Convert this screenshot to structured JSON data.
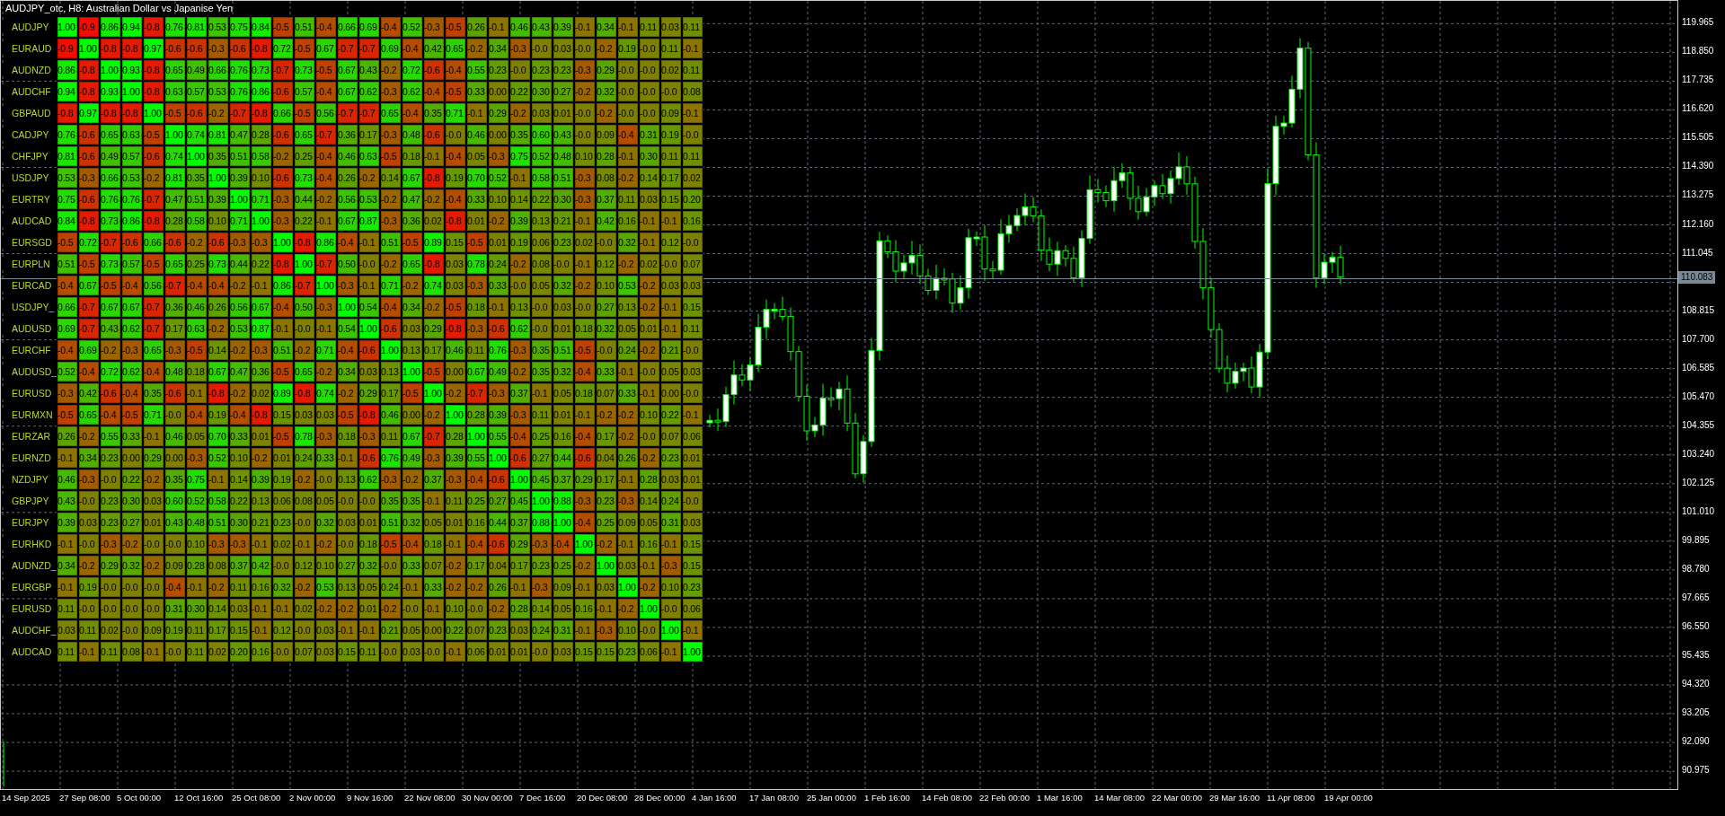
{
  "window": {
    "title": "AUDJPY_otc, H8: Australian Dollar vs Japanise Yen"
  },
  "correlation_matrix": {
    "rows": [
      {
        "symbol": "AUDJPY",
        "values": [
          "1.00",
          "-0.9",
          "0.86",
          "0.94",
          "-0.8",
          "0.76",
          "0.81",
          "0.53",
          "0.75",
          "0.84",
          "-0.5",
          "0.51",
          "-0.4",
          "0.66",
          "0.69",
          "-0.4",
          "0.52",
          "-0.3",
          "-0.5",
          "0.26",
          "-0.1",
          "0.46",
          "0.43",
          "0.39",
          "-0.1",
          "0.34",
          "-0.1",
          "0.11",
          "0.03",
          "0.11"
        ]
      },
      {
        "symbol": "EURAUD",
        "values": [
          "-0.9",
          "1.00",
          "-0.8",
          "-0.8",
          "0.97",
          "-0.6",
          "-0.6",
          "-0.3",
          "-0.6",
          "-0.8",
          "0.72",
          "-0.5",
          "0.67",
          "-0.7",
          "-0.7",
          "0.69",
          "-0.4",
          "0.42",
          "0.65",
          "-0.2",
          "0.34",
          "-0.3",
          "-0.0",
          "0.03",
          "-0.0",
          "-0.2",
          "0.19",
          "-0.0",
          "0.11",
          "-0.1"
        ]
      },
      {
        "symbol": "AUDNZD",
        "values": [
          "0.86",
          "-0.8",
          "1.00",
          "0.93",
          "-0.8",
          "0.65",
          "0.49",
          "0.66",
          "0.76",
          "0.73",
          "-0.7",
          "0.73",
          "-0.5",
          "0.67",
          "0.43",
          "-0.2",
          "0.72",
          "-0.6",
          "-0.4",
          "0.55",
          "0.23",
          "-0.0",
          "0.23",
          "0.23",
          "-0.3",
          "0.29",
          "-0.0",
          "-0.0",
          "0.02",
          "0.11"
        ]
      },
      {
        "symbol": "AUDCHF",
        "values": [
          "0.94",
          "-0.8",
          "0.93",
          "1.00",
          "-0.8",
          "0.63",
          "0.57",
          "0.53",
          "0.76",
          "0.86",
          "-0.6",
          "0.57",
          "-0.4",
          "0.67",
          "0.62",
          "-0.3",
          "0.62",
          "-0.4",
          "-0.5",
          "0.33",
          "0.00",
          "0.22",
          "0.30",
          "0.27",
          "-0.2",
          "0.32",
          "-0.0",
          "-0.0",
          "-0.0",
          "0.08"
        ]
      },
      {
        "symbol": "GBPAUD",
        "values": [
          "-0.8",
          "0.97",
          "-0.8",
          "-0.8",
          "1.00",
          "-0.5",
          "-0.6",
          "-0.2",
          "-0.7",
          "-0.8",
          "0.66",
          "-0.5",
          "0.56",
          "-0.7",
          "-0.7",
          "0.65",
          "-0.4",
          "0.35",
          "0.71",
          "-0.1",
          "0.29",
          "-0.2",
          "0.03",
          "0.01",
          "-0.0",
          "-0.2",
          "-0.0",
          "-0.0",
          "0.09",
          "-0.1"
        ]
      },
      {
        "symbol": "CADJPY",
        "values": [
          "0.76",
          "-0.6",
          "0.65",
          "0.63",
          "-0.5",
          "1.00",
          "0.74",
          "0.81",
          "0.47",
          "0.28",
          "-0.6",
          "0.65",
          "-0.7",
          "0.36",
          "0.17",
          "-0.3",
          "0.48",
          "-0.6",
          "-0.0",
          "0.46",
          "0.00",
          "0.35",
          "0.60",
          "0.43",
          "-0.0",
          "0.09",
          "-0.4",
          "0.31",
          "0.19",
          "-0.0"
        ]
      },
      {
        "symbol": "CHFJPY",
        "values": [
          "0.81",
          "-0.6",
          "0.49",
          "0.57",
          "-0.6",
          "0.74",
          "1.00",
          "0.35",
          "0.51",
          "0.58",
          "-0.2",
          "0.25",
          "-0.4",
          "0.46",
          "0.63",
          "-0.5",
          "0.18",
          "-0.1",
          "-0.4",
          "0.05",
          "-0.3",
          "0.75",
          "0.52",
          "0.48",
          "0.10",
          "0.28",
          "-0.1",
          "0.30",
          "0.11",
          "0.11"
        ]
      },
      {
        "symbol": "USDJPY",
        "values": [
          "0.53",
          "-0.3",
          "0.66",
          "0.53",
          "-0.2",
          "0.81",
          "0.35",
          "1.00",
          "0.39",
          "0.10",
          "-0.6",
          "0.73",
          "-0.4",
          "0.26",
          "-0.2",
          "0.14",
          "0.67",
          "-0.8",
          "0.19",
          "0.70",
          "0.52",
          "-0.1",
          "0.58",
          "0.51",
          "-0.3",
          "0.08",
          "-0.2",
          "0.14",
          "0.17",
          "0.02"
        ]
      },
      {
        "symbol": "EURTRY",
        "values": [
          "0.75",
          "-0.6",
          "0.76",
          "0.76",
          "-0.7",
          "0.47",
          "0.51",
          "0.39",
          "1.00",
          "0.71",
          "-0.3",
          "0.44",
          "-0.2",
          "0.56",
          "0.53",
          "-0.2",
          "0.47",
          "-0.2",
          "-0.4",
          "0.33",
          "0.10",
          "0.14",
          "0.22",
          "0.30",
          "-0.3",
          "0.37",
          "0.11",
          "0.03",
          "0.15",
          "0.20"
        ]
      },
      {
        "symbol": "AUDCAD",
        "values": [
          "0.84",
          "-0.8",
          "0.73",
          "0.86",
          "-0.8",
          "0.28",
          "0.58",
          "0.10",
          "0.71",
          "1.00",
          "-0.3",
          "0.22",
          "-0.1",
          "0.67",
          "0.87",
          "-0.3",
          "0.36",
          "0.02",
          "-0.8",
          "0.01",
          "-0.2",
          "0.39",
          "0.13",
          "0.21",
          "-0.1",
          "0.42",
          "0.16",
          "-0.1",
          "-0.1",
          "0.16"
        ]
      },
      {
        "symbol": "EURSGD",
        "values": [
          "-0.5",
          "0.72",
          "-0.7",
          "-0.6",
          "0.66",
          "-0.6",
          "-0.2",
          "-0.6",
          "-0.3",
          "-0.3",
          "1.00",
          "-0.8",
          "0.86",
          "-0.4",
          "-0.1",
          "0.51",
          "-0.5",
          "0.89",
          "0.15",
          "-0.5",
          "0.01",
          "0.19",
          "0.06",
          "0.23",
          "0.02",
          "-0.0",
          "0.32",
          "-0.1",
          "0.12",
          "-0.0"
        ]
      },
      {
        "symbol": "EURPLN",
        "values": [
          "0.51",
          "-0.5",
          "0.73",
          "0.57",
          "-0.5",
          "0.65",
          "0.25",
          "0.73",
          "0.44",
          "0.22",
          "-0.8",
          "1.00",
          "-0.7",
          "0.50",
          "-0.0",
          "-0.2",
          "0.65",
          "-0.8",
          "0.03",
          "0.78",
          "0.24",
          "-0.2",
          "0.08",
          "-0.0",
          "-0.1",
          "0.12",
          "-0.2",
          "0.02",
          "-0.0",
          "0.07"
        ]
      },
      {
        "symbol": "EURCAD",
        "values": [
          "-0.4",
          "0.67",
          "-0.5",
          "-0.4",
          "0.56",
          "-0.7",
          "-0.4",
          "-0.4",
          "-0.2",
          "-0.1",
          "0.86",
          "-0.7",
          "1.00",
          "-0.3",
          "-0.1",
          "0.71",
          "-0.2",
          "0.74",
          "0.03",
          "-0.3",
          "0.33",
          "-0.0",
          "0.05",
          "0.32",
          "-0.2",
          "0.10",
          "0.53",
          "-0.2",
          "0.03",
          "0.03"
        ]
      },
      {
        "symbol": "USDJPY_",
        "values": [
          "0.66",
          "-0.7",
          "0.67",
          "0.67",
          "-0.7",
          "0.36",
          "0.46",
          "0.26",
          "0.56",
          "0.67",
          "-0.4",
          "0.50",
          "-0.3",
          "1.00",
          "0.54",
          "-0.4",
          "0.34",
          "-0.2",
          "-0.5",
          "0.18",
          "-0.1",
          "0.13",
          "-0.0",
          "0.03",
          "-0.0",
          "0.27",
          "0.13",
          "-0.2",
          "-0.1",
          "0.15"
        ]
      },
      {
        "symbol": "AUDUSD",
        "values": [
          "0.69",
          "-0.7",
          "0.43",
          "0.62",
          "-0.7",
          "0.17",
          "0.63",
          "-0.2",
          "0.53",
          "0.87",
          "-0.1",
          "-0.0",
          "-0.1",
          "0.54",
          "1.00",
          "-0.6",
          "0.03",
          "0.29",
          "-0.8",
          "-0.3",
          "-0.6",
          "0.62",
          "-0.0",
          "0.01",
          "0.18",
          "0.32",
          "0.05",
          "0.01",
          "-0.1",
          "0.11"
        ]
      },
      {
        "symbol": "EURCHF",
        "values": [
          "-0.4",
          "0.69",
          "-0.2",
          "-0.3",
          "0.65",
          "-0.3",
          "-0.5",
          "0.14",
          "-0.2",
          "-0.3",
          "0.51",
          "-0.2",
          "0.71",
          "-0.4",
          "-0.6",
          "1.00",
          "0.13",
          "0.17",
          "0.46",
          "0.11",
          "0.76",
          "-0.3",
          "0.35",
          "0.51",
          "-0.5",
          "-0.0",
          "0.24",
          "-0.2",
          "0.21",
          "-0.0"
        ]
      },
      {
        "symbol": "AUDUSD_",
        "values": [
          "0.52",
          "-0.4",
          "0.72",
          "0.62",
          "-0.4",
          "0.48",
          "0.18",
          "0.67",
          "0.47",
          "0.36",
          "-0.5",
          "0.65",
          "-0.2",
          "0.34",
          "0.03",
          "0.13",
          "1.00",
          "-0.5",
          "0.00",
          "0.67",
          "0.49",
          "-0.2",
          "0.35",
          "0.32",
          "-0.4",
          "0.33",
          "-0.1",
          "-0.0",
          "0.05",
          "0.03"
        ]
      },
      {
        "symbol": "EURUSD",
        "values": [
          "-0.3",
          "0.42",
          "-0.6",
          "-0.4",
          "0.35",
          "-0.6",
          "-0.1",
          "-0.8",
          "-0.2",
          "0.02",
          "0.89",
          "-0.8",
          "0.74",
          "-0.2",
          "0.29",
          "0.17",
          "-0.5",
          "1.00",
          "-0.2",
          "-0.7",
          "-0.3",
          "0.37",
          "-0.1",
          "0.05",
          "0.18",
          "0.07",
          "0.33",
          "-0.1",
          "0.00",
          "-0.0"
        ]
      },
      {
        "symbol": "EURMXN",
        "values": [
          "-0.5",
          "0.65",
          "-0.4",
          "-0.5",
          "0.71",
          "-0.0",
          "-0.4",
          "0.19",
          "-0.4",
          "-0.8",
          "0.15",
          "0.03",
          "0.03",
          "-0.5",
          "-0.8",
          "0.46",
          "0.00",
          "-0.2",
          "1.00",
          "0.28",
          "0.39",
          "-0.3",
          "0.11",
          "0.01",
          "-0.1",
          "-0.2",
          "-0.2",
          "0.10",
          "0.22",
          "-0.1"
        ]
      },
      {
        "symbol": "EURZAR",
        "values": [
          "0.26",
          "-0.2",
          "0.55",
          "0.33",
          "-0.1",
          "0.46",
          "0.05",
          "0.70",
          "0.33",
          "0.01",
          "-0.5",
          "0.78",
          "-0.3",
          "0.18",
          "-0.3",
          "0.11",
          "0.67",
          "-0.7",
          "0.28",
          "1.00",
          "0.55",
          "-0.4",
          "0.25",
          "0.16",
          "-0.4",
          "0.17",
          "-0.2",
          "-0.0",
          "0.07",
          "0.06"
        ]
      },
      {
        "symbol": "EURNZD",
        "values": [
          "-0.1",
          "0.34",
          "0.23",
          "0.00",
          "0.29",
          "0.00",
          "-0.3",
          "0.52",
          "0.10",
          "-0.2",
          "0.01",
          "0.24",
          "0.33",
          "-0.1",
          "-0.6",
          "0.76",
          "0.49",
          "-0.3",
          "0.39",
          "0.55",
          "1.00",
          "-0.6",
          "0.27",
          "0.44",
          "-0.6",
          "0.04",
          "0.26",
          "-0.2",
          "0.23",
          "0.01"
        ]
      },
      {
        "symbol": "NZDJPY",
        "values": [
          "0.46",
          "-0.3",
          "-0.0",
          "0.22",
          "-0.2",
          "0.35",
          "0.75",
          "-0.1",
          "0.14",
          "0.39",
          "0.19",
          "-0.2",
          "-0.0",
          "0.13",
          "0.62",
          "-0.3",
          "-0.2",
          "0.37",
          "-0.3",
          "-0.4",
          "-0.6",
          "1.00",
          "0.45",
          "0.37",
          "0.29",
          "0.17",
          "-0.1",
          "0.28",
          "0.03",
          "0.01"
        ]
      },
      {
        "symbol": "GBPJPY",
        "values": [
          "0.43",
          "-0.0",
          "0.23",
          "0.30",
          "0.03",
          "0.60",
          "0.52",
          "0.58",
          "0.22",
          "0.13",
          "0.06",
          "0.08",
          "0.05",
          "-0.0",
          "-0.0",
          "0.35",
          "0.35",
          "-0.1",
          "0.11",
          "0.25",
          "0.27",
          "0.45",
          "1.00",
          "0.88",
          "-0.3",
          "0.23",
          "-0.3",
          "0.14",
          "0.24",
          "-0.0"
        ]
      },
      {
        "symbol": "EURJPY",
        "values": [
          "0.39",
          "0.03",
          "0.23",
          "0.27",
          "0.01",
          "0.43",
          "0.48",
          "0.51",
          "0.30",
          "0.21",
          "0.23",
          "-0.0",
          "0.32",
          "0.03",
          "0.01",
          "0.51",
          "0.32",
          "0.05",
          "0.01",
          "0.16",
          "0.44",
          "0.37",
          "0.88",
          "1.00",
          "-0.4",
          "0.25",
          "0.09",
          "0.05",
          "0.31",
          "0.03"
        ]
      },
      {
        "symbol": "EURHKD",
        "values": [
          "-0.1",
          "-0.0",
          "-0.3",
          "-0.2",
          "-0.0",
          "-0.0",
          "0.10",
          "-0.3",
          "-0.3",
          "-0.1",
          "0.02",
          "-0.1",
          "-0.2",
          "-0.0",
          "0.18",
          "-0.5",
          "-0.4",
          "0.18",
          "-0.1",
          "-0.4",
          "-0.6",
          "0.29",
          "-0.3",
          "-0.4",
          "1.00",
          "-0.2",
          "-0.1",
          "0.16",
          "-0.1",
          "0.15"
        ]
      },
      {
        "symbol": "AUDNZD_",
        "values": [
          "0.34",
          "-0.2",
          "0.29",
          "0.32",
          "-0.2",
          "0.09",
          "0.28",
          "0.08",
          "0.37",
          "0.42",
          "-0.0",
          "0.12",
          "0.10",
          "0.27",
          "0.32",
          "-0.0",
          "0.33",
          "0.07",
          "-0.2",
          "0.17",
          "0.04",
          "0.17",
          "0.23",
          "0.25",
          "-0.2",
          "1.00",
          "0.03",
          "-0.1",
          "-0.3",
          "0.15"
        ]
      },
      {
        "symbol": "EURGBP",
        "values": [
          "-0.1",
          "0.19",
          "-0.0",
          "-0.0",
          "-0.0",
          "-0.4",
          "-0.1",
          "-0.2",
          "0.11",
          "0.16",
          "0.32",
          "-0.2",
          "0.53",
          "0.13",
          "0.05",
          "0.24",
          "-0.1",
          "0.33",
          "-0.2",
          "-0.2",
          "0.26",
          "-0.1",
          "-0.3",
          "0.09",
          "-0.1",
          "0.03",
          "1.00",
          "-0.2",
          "0.10",
          "0.23"
        ]
      },
      {
        "symbol": "EURUSD",
        "values": [
          "0.11",
          "-0.0",
          "-0.0",
          "-0.0",
          "-0.0",
          "0.31",
          "0.30",
          "0.14",
          "0.03",
          "-0.1",
          "-0.1",
          "0.02",
          "-0.2",
          "-0.2",
          "0.01",
          "-0.2",
          "-0.0",
          "-0.1",
          "0.10",
          "-0.0",
          "-0.2",
          "0.28",
          "0.14",
          "0.05",
          "0.16",
          "-0.1",
          "-0.2",
          "1.00",
          "-0.0",
          "0.06"
        ]
      },
      {
        "symbol": "AUDCHF_",
        "values": [
          "0.03",
          "0.11",
          "0.02",
          "-0.0",
          "0.09",
          "0.19",
          "0.11",
          "0.17",
          "0.15",
          "-0.1",
          "0.12",
          "-0.0",
          "0.03",
          "-0.1",
          "-0.1",
          "0.21",
          "0.05",
          "0.00",
          "0.22",
          "0.07",
          "0.23",
          "0.03",
          "0.24",
          "0.31",
          "-0.1",
          "-0.3",
          "0.10",
          "-0.0",
          "1.00",
          "-0.1"
        ]
      },
      {
        "symbol": "AUDCAD",
        "values": [
          "0.11",
          "-0.1",
          "0.11",
          "0.08",
          "-0.1",
          "-0.0",
          "0.11",
          "0.02",
          "0.20",
          "0.16",
          "-0.0",
          "0.07",
          "0.03",
          "0.15",
          "0.11",
          "-0.0",
          "0.03",
          "-0.0",
          "-0.1",
          "0.06",
          "0.01",
          "0.01",
          "-0.0",
          "0.03",
          "0.15",
          "0.15",
          "0.23",
          "0.06",
          "-0.1",
          "1.00"
        ]
      }
    ]
  },
  "price_axis": {
    "labels": [
      "119.965",
      "118.850",
      "117.735",
      "116.620",
      "115.505",
      "114.390",
      "113.275",
      "112.160",
      "111.045",
      "108.815",
      "107.700",
      "106.585",
      "105.470",
      "104.355",
      "103.240",
      "102.125",
      "101.010",
      "99.895",
      "98.780",
      "97.665",
      "96.550",
      "95.435",
      "94.320",
      "93.205",
      "92.090",
      "90.975"
    ],
    "current_price": "110.083"
  },
  "time_axis": {
    "labels": [
      "14 Sep 2025",
      "27 Sep 08:00",
      "5 Oct 00:00",
      "12 Oct 16:00",
      "25 Oct 08:00",
      "2 Nov 00:00",
      "9 Nov 16:00",
      "22 Nov 08:00",
      "30 Nov 00:00",
      "7 Dec 16:00",
      "20 Dec 08:00",
      "28 Dec 00:00",
      "4 Jan 16:00",
      "17 Jan 08:00",
      "25 Jan 00:00",
      "1 Feb 16:00",
      "14 Feb 08:00",
      "22 Feb 00:00",
      "1 Mar 16:00",
      "14 Mar 08:00",
      "22 Mar 00:00",
      "29 Mar 16:00",
      "11 Apr 08:00",
      "19 Apr 00:00"
    ]
  }
}
